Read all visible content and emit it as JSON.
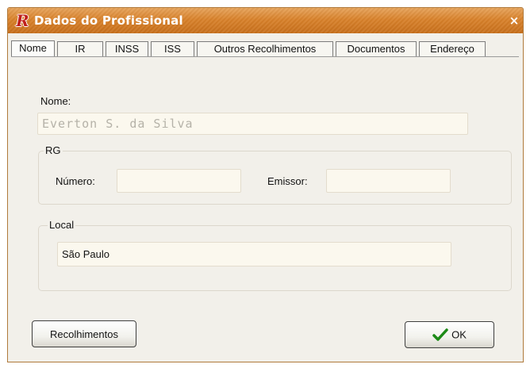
{
  "window": {
    "title": "Dados do Profissional",
    "logo_letter": "R",
    "close_glyph": "×",
    "accent_color": "#d9822b"
  },
  "tabs": [
    {
      "label": "Nome",
      "active": true
    },
    {
      "label": "IR",
      "active": false
    },
    {
      "label": "INSS",
      "active": false
    },
    {
      "label": "ISS",
      "active": false
    },
    {
      "label": "Outros Recolhimentos",
      "active": false
    },
    {
      "label": "Documentos",
      "active": false
    },
    {
      "label": "Endereço",
      "active": false
    }
  ],
  "form": {
    "nome_label": "Nome:",
    "nome_value": "Everton S. da Silva",
    "rg": {
      "title": "RG",
      "numero_label": "Número:",
      "numero_value": "",
      "emissor_label": "Emissor:",
      "emissor_value": ""
    },
    "local": {
      "title": "Local",
      "value": "São Paulo"
    }
  },
  "buttons": {
    "recolhimentos_label": "Recolhimentos",
    "ok_label": "OK",
    "ok_icon": "check-icon"
  }
}
